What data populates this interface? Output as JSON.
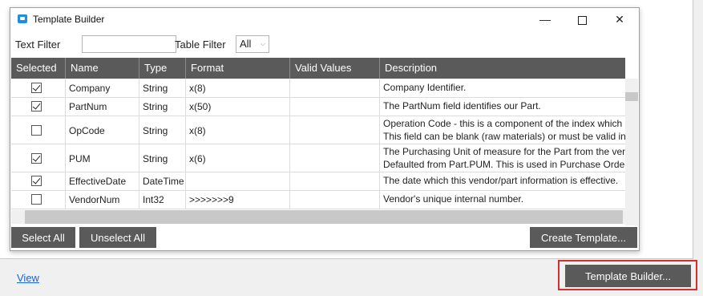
{
  "dialog": {
    "title": "Template Builder",
    "filters": {
      "text_filter_label": "Text Filter",
      "text_filter_value": "",
      "table_filter_label": "Table Filter",
      "table_filter_value": "All"
    },
    "columns": [
      "Selected",
      "Name",
      "Type",
      "Format",
      "Valid Values",
      "Description"
    ],
    "rows": [
      {
        "selected": true,
        "name": "Company",
        "type": "String",
        "format": "x(8)",
        "valid": "",
        "desc": [
          "Company Identifier."
        ]
      },
      {
        "selected": true,
        "name": "PartNum",
        "type": "String",
        "format": "x(50)",
        "valid": "",
        "desc": [
          "The PartNum field identifies our Part."
        ]
      },
      {
        "selected": false,
        "name": "OpCode",
        "type": "String",
        "format": "x(8)",
        "valid": "",
        "desc": [
          "Operation Code - this is a component of the index which",
          "This field can be blank (raw materials) or must be valid in"
        ]
      },
      {
        "selected": true,
        "name": "PUM",
        "type": "String",
        "format": "x(6)",
        "valid": "",
        "desc": [
          "The Purchasing Unit of measure for the Part from the ven",
          "Defaulted from Part.PUM.  This is used in Purchase Order"
        ]
      },
      {
        "selected": true,
        "name": "EffectiveDate",
        "type": "DateTime",
        "format": "",
        "valid": "",
        "desc": [
          "The date which this vendor/part information is effective."
        ]
      },
      {
        "selected": false,
        "name": "VendorNum",
        "type": "Int32",
        "format": ">>>>>>>9",
        "valid": "",
        "desc": [
          "Vendor's unique internal number."
        ]
      }
    ],
    "buttons": {
      "select_all": "Select All",
      "unselect_all": "Unselect All",
      "create_template": "Create Template..."
    }
  },
  "background": {
    "view_link": "View",
    "template_builder_button": "Template Builder..."
  },
  "colors": {
    "header_bg": "#5a5a5a",
    "button_bg": "#5a5a5a",
    "highlight_border": "#d62e2e",
    "link": "#1a64c8",
    "app_icon": "#1e8fd8"
  }
}
